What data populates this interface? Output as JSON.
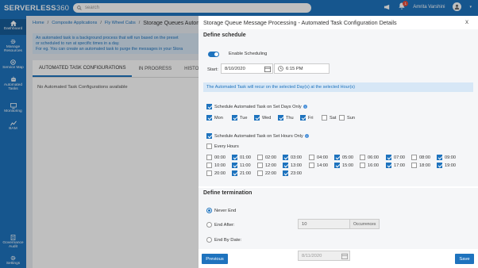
{
  "app": {
    "logo_a": "SERVERLESS",
    "logo_b": "360",
    "search_placeholder": "search",
    "user_name": "Amrita Varshini",
    "notification_count": "1"
  },
  "sidebar": {
    "items": [
      {
        "label": "Dashboard",
        "icon": "home-icon"
      },
      {
        "label": "Manage Resources",
        "icon": "gear-icon"
      },
      {
        "label": "Service Map",
        "icon": "map-icon"
      },
      {
        "label": "Automated Tasks",
        "icon": "robot-icon"
      },
      {
        "label": "Monitoring",
        "icon": "monitor-icon"
      },
      {
        "label": "BAM",
        "icon": "chart-icon"
      },
      {
        "label": "Governance Audit",
        "icon": "audit-icon"
      },
      {
        "label": "Settings",
        "icon": "settings-icon"
      }
    ]
  },
  "breadcrumb": {
    "home": "Home",
    "app": "Composite Applications",
    "resource": "Fly Wheel Cabs",
    "page": "Storage Queues Automat"
  },
  "info": {
    "line1": "An automated task is a background process that will run based on the preset",
    "line2": "or scheduled to run at specific times in a day.",
    "line3": "For eg. You can create an automated task to purge the messages in your Stora"
  },
  "tabs": [
    "AUTOMATED TASK CONFIGURATIONS",
    "IN PROGRESS",
    "HISTORY"
  ],
  "empty_text": "No Automated Task Configurations available",
  "modal": {
    "title": "Storage Queue Message Processing - Automated Task Configuration Details",
    "close": "x",
    "schedule_title": "Define schedule",
    "enable_label": "Enable Scheduling",
    "start_label": "Start:",
    "start_date": "8/10/2020",
    "start_time": "6:15 PM",
    "note": "The Automated Task will recur on the selected Day(s) at the selected Hour(s)",
    "days_label": "Schedule Automated Task on Set Days Only",
    "days": [
      {
        "label": "Mon",
        "checked": true
      },
      {
        "label": "Tue",
        "checked": true
      },
      {
        "label": "Wed",
        "checked": true
      },
      {
        "label": "Thu",
        "checked": true
      },
      {
        "label": "Fri",
        "checked": true
      },
      {
        "label": "Sat",
        "checked": false
      },
      {
        "label": "Sun",
        "checked": false
      }
    ],
    "hours_label": "Schedule Automated Task on Set Hours Only",
    "every_hours": "Every Hours",
    "hours": [
      {
        "label": "00:00",
        "checked": false
      },
      {
        "label": "01:00",
        "checked": true
      },
      {
        "label": "02:00",
        "checked": false
      },
      {
        "label": "03:00",
        "checked": true
      },
      {
        "label": "04:00",
        "checked": false
      },
      {
        "label": "05:00",
        "checked": true
      },
      {
        "label": "06:00",
        "checked": false
      },
      {
        "label": "07:00",
        "checked": true
      },
      {
        "label": "08:00",
        "checked": false
      },
      {
        "label": "09:00",
        "checked": true
      },
      {
        "label": "10:00",
        "checked": false
      },
      {
        "label": "11:00",
        "checked": true
      },
      {
        "label": "12:00",
        "checked": false
      },
      {
        "label": "13:00",
        "checked": true
      },
      {
        "label": "14:00",
        "checked": false
      },
      {
        "label": "15:00",
        "checked": true
      },
      {
        "label": "16:00",
        "checked": false
      },
      {
        "label": "17:00",
        "checked": true
      },
      {
        "label": "18:00",
        "checked": false
      },
      {
        "label": "19:00",
        "checked": true
      },
      {
        "label": "20:00",
        "checked": false
      },
      {
        "label": "21:00",
        "checked": true
      },
      {
        "label": "22:00",
        "checked": false
      },
      {
        "label": "23:00",
        "checked": true
      }
    ],
    "termination_title": "Define termination",
    "never_end": "Never End",
    "end_after": "End After:",
    "end_after_value": "10",
    "occurrences": "Occurrences",
    "end_by": "End By Date:",
    "end_by_value": "8/11/2020",
    "previous": "Previous",
    "save": "Save"
  },
  "colors": {
    "primary": "#1e73be",
    "info_bg": "#d7e7f6"
  }
}
